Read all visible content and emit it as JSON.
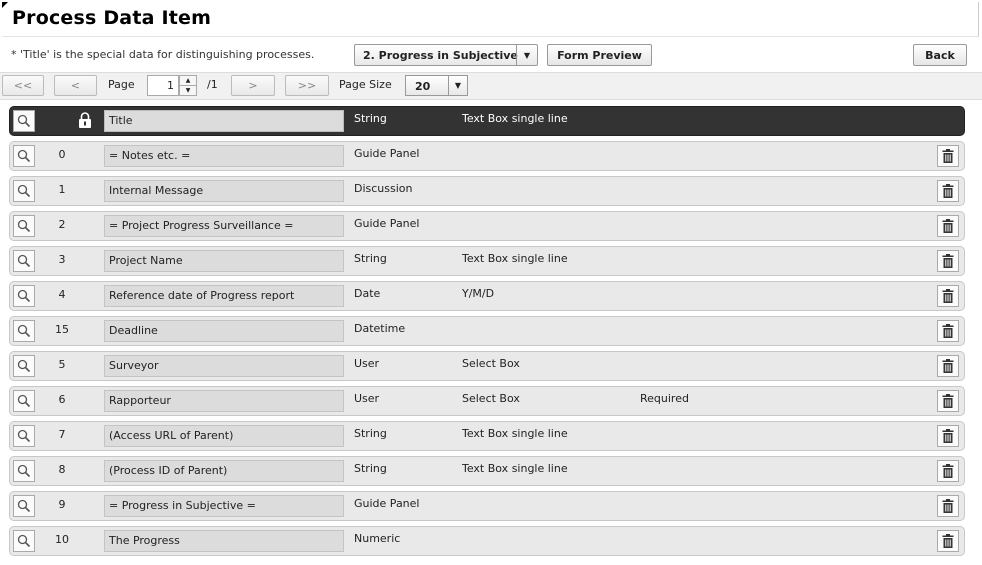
{
  "page": {
    "title": "Process Data Item",
    "note": "* 'Title' is the special data for distinguishing processes."
  },
  "header_controls": {
    "process_select": "2. Progress in Subjective",
    "form_preview": "Form Preview",
    "back": "Back"
  },
  "pagination": {
    "first": "<<",
    "prev": "<",
    "page_label": "Page",
    "page_value": "1",
    "page_total": "/1",
    "next": ">",
    "last": ">>",
    "page_size_label": "Page Size",
    "page_size_value": "20"
  },
  "rows": [
    {
      "num": "",
      "name": "Title",
      "type": "String",
      "widget": "Text Box single line",
      "req": "",
      "header": true
    },
    {
      "num": "0",
      "name": "= Notes etc. =",
      "type": "Guide Panel",
      "widget": "",
      "req": ""
    },
    {
      "num": "1",
      "name": "Internal Message",
      "type": "Discussion",
      "widget": "",
      "req": ""
    },
    {
      "num": "2",
      "name": "= Project Progress Surveillance =",
      "type": "Guide Panel",
      "widget": "",
      "req": ""
    },
    {
      "num": "3",
      "name": "Project Name",
      "type": "String",
      "widget": "Text Box single line",
      "req": ""
    },
    {
      "num": "4",
      "name": "Reference date of Progress report",
      "type": "Date",
      "widget": "Y/M/D",
      "req": ""
    },
    {
      "num": "15",
      "name": "Deadline",
      "type": "Datetime",
      "widget": "",
      "req": ""
    },
    {
      "num": "5",
      "name": "Surveyor",
      "type": "User",
      "widget": "Select Box",
      "req": ""
    },
    {
      "num": "6",
      "name": "Rapporteur",
      "type": "User",
      "widget": "Select Box",
      "req": "Required"
    },
    {
      "num": "7",
      "name": "(Access URL of Parent)",
      "type": "String",
      "widget": "Text Box single line",
      "req": ""
    },
    {
      "num": "8",
      "name": "(Process ID of Parent)",
      "type": "String",
      "widget": "Text Box single line",
      "req": ""
    },
    {
      "num": "9",
      "name": "= Progress in Subjective =",
      "type": "Guide Panel",
      "widget": "",
      "req": ""
    },
    {
      "num": "10",
      "name": "The Progress",
      "type": "Numeric",
      "widget": "",
      "req": ""
    }
  ],
  "icons": {
    "inspect": "magnifier-icon",
    "lock": "lock-icon",
    "delete": "trash-icon"
  },
  "colors": {
    "header_row": "#333333",
    "row_bg": "#e9e9e9"
  }
}
